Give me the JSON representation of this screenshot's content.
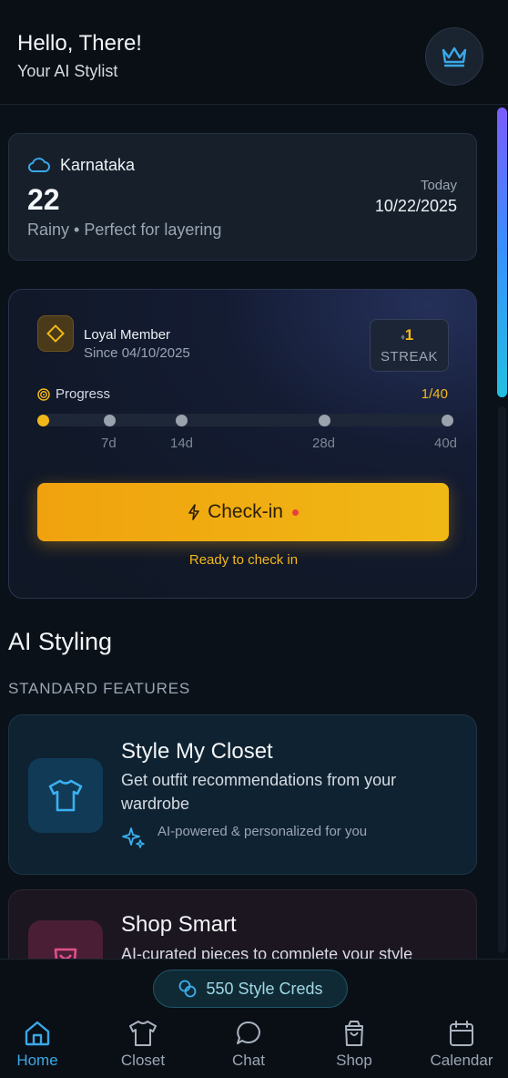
{
  "header": {
    "greeting": "Hello, There!",
    "subtitle": "Your AI Stylist",
    "premium_icon": "crown-icon"
  },
  "weather": {
    "location": "Karnataka",
    "temperature": "22",
    "description": "Rainy • Perfect for layering",
    "today_label": "Today",
    "date": "10/22/2025",
    "icon": "cloud-icon"
  },
  "loyalty": {
    "title": "Loyal Member",
    "since": "Since 04/10/2025",
    "streak_value": "1",
    "streak_label": "STREAK",
    "progress_label": "Progress",
    "progress_count": "1/40",
    "progress_value": 1,
    "progress_max": 40,
    "milestones": [
      "7d",
      "14d",
      "28d",
      "40d"
    ],
    "checkin_label": "Check-in",
    "status": "Ready to check in"
  },
  "ai_styling": {
    "title": "AI Styling",
    "section_label": "STANDARD FEATURES",
    "features": [
      {
        "title": "Style My Closet",
        "description": "Get outfit recommendations from your wardrobe",
        "tagline": "AI-powered & personalized for you",
        "icon": "shirt-icon"
      },
      {
        "title": "Shop Smart",
        "description": "AI-curated pieces to complete your style",
        "icon": "shopping-bag-icon"
      }
    ]
  },
  "credits": {
    "label": "550 Style Creds",
    "icon": "coins-icon"
  },
  "nav": {
    "items": [
      {
        "label": "Home",
        "icon": "home-icon",
        "active": true
      },
      {
        "label": "Closet",
        "icon": "shirt-icon",
        "active": false
      },
      {
        "label": "Chat",
        "icon": "chat-icon",
        "active": false
      },
      {
        "label": "Shop",
        "icon": "shopping-bag-icon",
        "active": false
      },
      {
        "label": "Calendar",
        "icon": "calendar-icon",
        "active": false
      }
    ]
  },
  "colors": {
    "accent_blue": "#3aa8e8",
    "accent_gold": "#f5b81c",
    "background": "#0b1119"
  }
}
